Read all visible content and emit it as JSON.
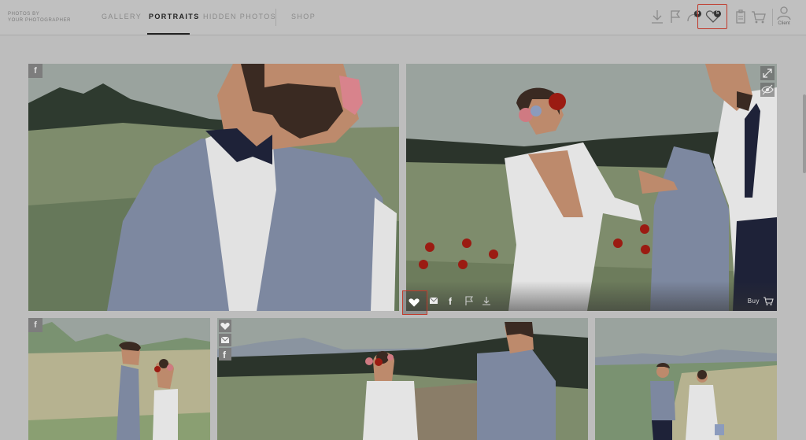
{
  "brand": {
    "line1": "PHOTOS BY",
    "line2": "YOUR PHOTOGRAPHER"
  },
  "nav": {
    "items": [
      {
        "label": "GALLERY",
        "active": false
      },
      {
        "label": "PORTRAITS",
        "active": true
      },
      {
        "label": "HIDDEN PHOTOS",
        "active": false
      },
      {
        "label": "SHOP",
        "active": false
      }
    ]
  },
  "header_icons": {
    "share_count": "5",
    "favorites_count": "5",
    "client_label": "Client"
  },
  "photos": {
    "facebook_glyph": "f",
    "buy_label": "Buy"
  },
  "colors": {
    "accent_highlight": "#c0392b",
    "active_text": "#222222"
  }
}
